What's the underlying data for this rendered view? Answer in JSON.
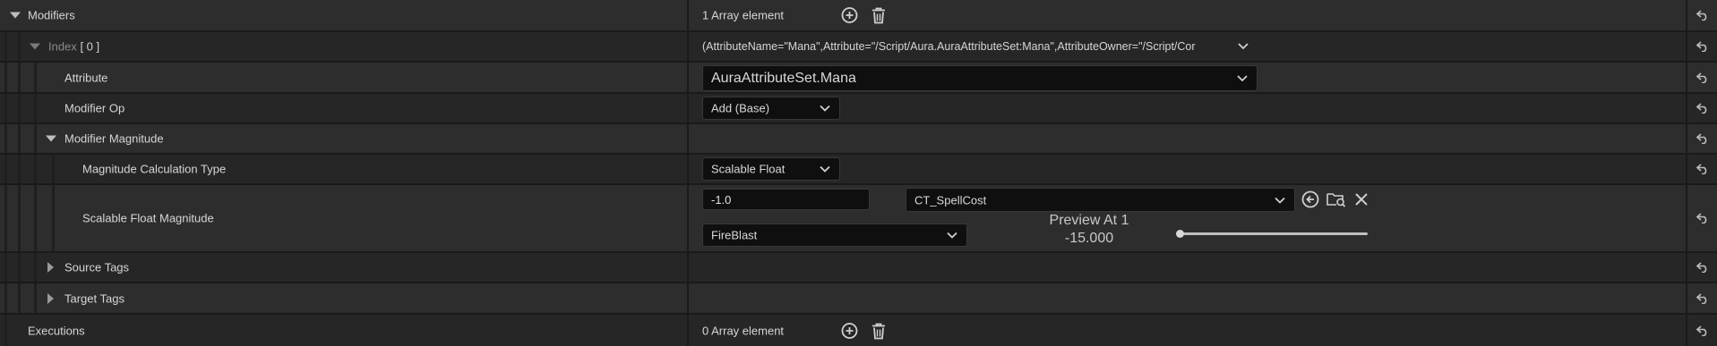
{
  "modifiers": {
    "label": "Modifiers",
    "array_count": "1 Array element",
    "add_icon": "plus-circle-icon",
    "delete_icon": "trash-icon"
  },
  "index_row": {
    "label_prefix": "Index",
    "label_index": "[ 0 ]",
    "value": "(AttributeName=\"Mana\",Attribute=\"/Script/Aura.AuraAttributeSet:Mana\",AttributeOwner=\"/Script/Cor"
  },
  "attribute": {
    "label": "Attribute",
    "value": "AuraAttributeSet.Mana"
  },
  "modifier_op": {
    "label": "Modifier Op",
    "value": "Add (Base)"
  },
  "modifier_magnitude": {
    "label": "Modifier Magnitude"
  },
  "magnitude_calc_type": {
    "label": "Magnitude Calculation Type",
    "value": "Scalable Float"
  },
  "scalable_float": {
    "label": "Scalable Float Magnitude",
    "value": "-1.0",
    "curve_table": "CT_SpellCost",
    "row_name": "FireBlast",
    "preview_title": "Preview At 1",
    "preview_value": "-15.000",
    "preview_slider_fraction": 0,
    "icons": [
      "use-selected-icon",
      "browse-folder-icon",
      "clear-icon"
    ]
  },
  "source_tags": {
    "label": "Source Tags"
  },
  "target_tags": {
    "label": "Target Tags"
  },
  "executions": {
    "label": "Executions",
    "array_count": "0 Array element"
  },
  "reset_icon": "reset-to-default-icon",
  "colors": {
    "background": "#2d2d2d",
    "field": "#0f0f0f",
    "separator": "#1a1a1a"
  }
}
